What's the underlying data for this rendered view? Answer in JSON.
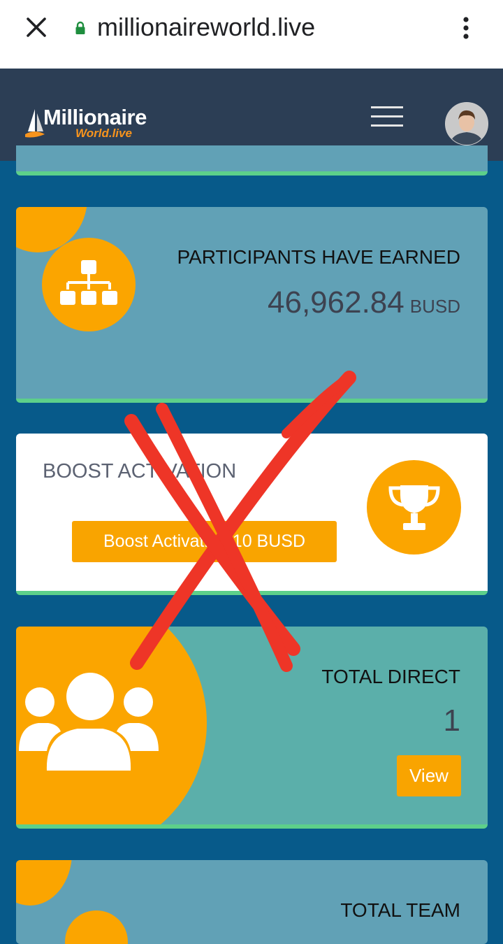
{
  "browser": {
    "url": "millionaireworld.live",
    "close_icon": "close-icon",
    "lock_icon": "lock-icon",
    "menu_icon": "more-vert-icon"
  },
  "header": {
    "logo_name": "Millionaire",
    "logo_sub": "World.live",
    "menu_icon": "hamburger-icon",
    "avatar_icon": "user-avatar"
  },
  "cards": {
    "participants": {
      "title": "PARTICIPANTS HAVE EARNED",
      "value": "46,962.84",
      "unit": "BUSD",
      "icon": "sitemap-icon"
    },
    "boost": {
      "title": "BOOST ACTIVATION",
      "button_label": "Boost Activation 10 BUSD",
      "icon": "trophy-icon"
    },
    "direct": {
      "title": "TOTAL DIRECT",
      "value": "1",
      "button_label": "View",
      "icon": "users-icon"
    },
    "team": {
      "title": "TOTAL TEAM"
    }
  },
  "colors": {
    "page_bg": "#075a8a",
    "header_bg": "#2c3e55",
    "accent_orange": "#fba500",
    "card_blue": "#61a1b6",
    "card_teal": "#5bafaa",
    "card_border_green": "#5dd08a",
    "overlay_red": "#ee3527"
  }
}
